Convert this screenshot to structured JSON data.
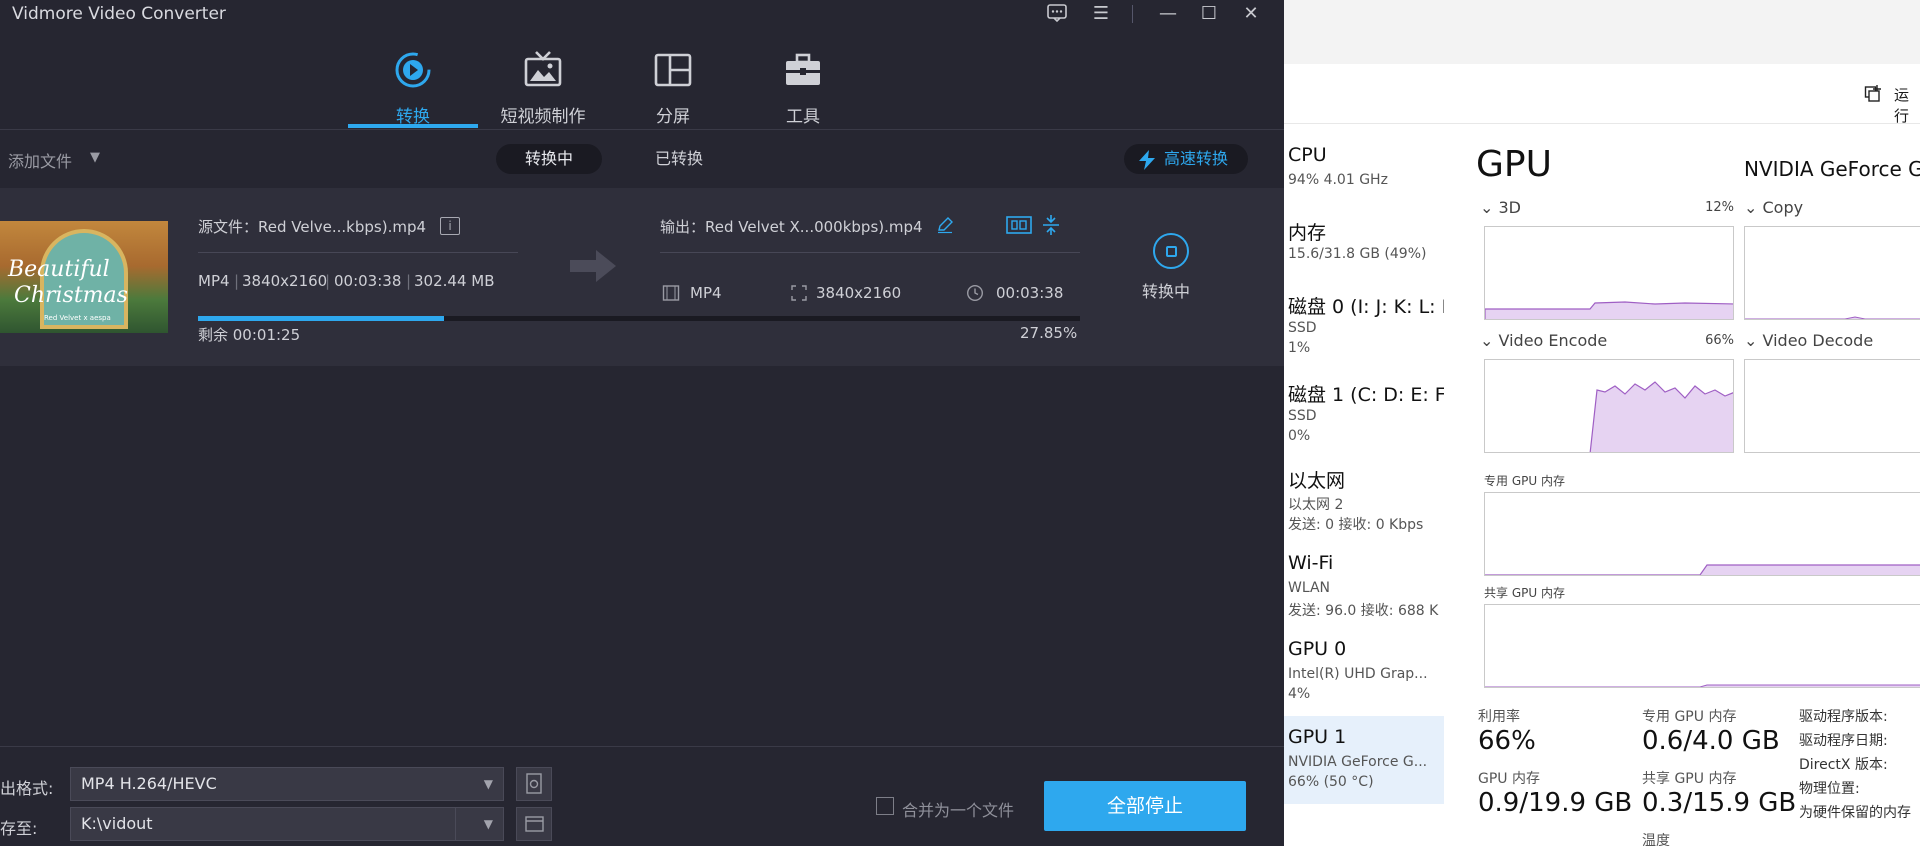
{
  "vidmore": {
    "title": "Vidmore Video Converter",
    "window_controls": {
      "feedback": "feedback-icon",
      "menu": "☰",
      "minimize": "—",
      "maximize": "☐",
      "close": "✕"
    },
    "tabs": [
      {
        "label": "转换",
        "icon": "convert-icon",
        "active": true
      },
      {
        "label": "短视频制作",
        "icon": "tv-icon",
        "active": false
      },
      {
        "label": "分屏",
        "icon": "collage-icon",
        "active": false
      },
      {
        "label": "工具",
        "icon": "toolbox-icon",
        "active": false
      }
    ],
    "toolbar": {
      "add_file": "添加文件",
      "converting": "转换中",
      "converted": "已转换",
      "fast_convert": "高速转换"
    },
    "task": {
      "source": "源文件：Red Velve...kbps).mp4",
      "source_meta": {
        "format": "MP4",
        "resolution": "3840x2160",
        "duration": "00:03:38",
        "size": "302.44 MB"
      },
      "output": "输出：Red Velvet X...000kbps).mp4",
      "output_meta": {
        "format": "MP4",
        "resolution": "3840x2160",
        "duration": "00:03:38"
      },
      "remaining": "剩余 00:01:25",
      "percent_text": "27.85%",
      "progress": 0.2785,
      "status": "转换中",
      "thumb_title_1": "Beautiful",
      "thumb_title_2": "Christmas",
      "thumb_sub": "Red Velvet x aespa"
    },
    "bottom": {
      "format_label": "出格式:",
      "format_value": "MP4 H.264/HEVC",
      "save_label": "存至:",
      "save_value": "K:\\vidout",
      "merge_label": "合并为一个文件",
      "stop_all": "全部停止"
    },
    "accent": "#2ea8ee"
  },
  "taskmgr": {
    "run_label": "运行",
    "sidebar": [
      {
        "name": "CPU",
        "sub1": "94% 4.01 GHz",
        "sub2": ""
      },
      {
        "name": "内存",
        "sub1": "15.6/31.8 GB (49%)",
        "sub2": ""
      },
      {
        "name": "磁盘 0 (I: J: K: L: I",
        "sub1": "SSD",
        "sub2": "1%"
      },
      {
        "name": "磁盘 1 (C: D: E: F:",
        "sub1": "SSD",
        "sub2": "0%"
      },
      {
        "name": "以太网",
        "sub1": "以太网 2",
        "sub2": "发送: 0 接收: 0 Kbps"
      },
      {
        "name": "Wi-Fi",
        "sub1": "WLAN",
        "sub2": "发送: 96.0 接收: 688 K"
      },
      {
        "name": "GPU 0",
        "sub1": "Intel(R) UHD Grap...",
        "sub2": "4%"
      },
      {
        "name": "GPU 1",
        "sub1": "NVIDIA GeForce G...",
        "sub2": "66% (50 °C)"
      }
    ],
    "gpu_title": "GPU",
    "gpu_model": "NVIDIA GeForce G",
    "engines": {
      "3d": {
        "label": "3D",
        "pct": "12%"
      },
      "copy": {
        "label": "Copy"
      },
      "encode": {
        "label": "Video Encode",
        "pct": "66%"
      },
      "decode": {
        "label": "Video Decode"
      }
    },
    "dedicated_label": "专用 GPU 内存",
    "shared_label": "共享 GPU 内存",
    "stats": {
      "util_label": "利用率",
      "util_value": "66%",
      "ded_label": "专用 GPU 内存",
      "ded_value": "0.6/4.0 GB",
      "gpumem_label": "GPU 内存",
      "gpumem_value": "0.9/19.9 GB",
      "shared_label": "共享 GPU 内存",
      "shared_value": "0.3/15.9 GB",
      "temp_label": "温度"
    },
    "driver": {
      "version": "驱动程序版本:",
      "date": "驱动程序日期:",
      "directx": "DirectX 版本:",
      "location": "物理位置:",
      "reserved": "为硬件保留的内存"
    },
    "graph_color": "#9f5fc4"
  }
}
